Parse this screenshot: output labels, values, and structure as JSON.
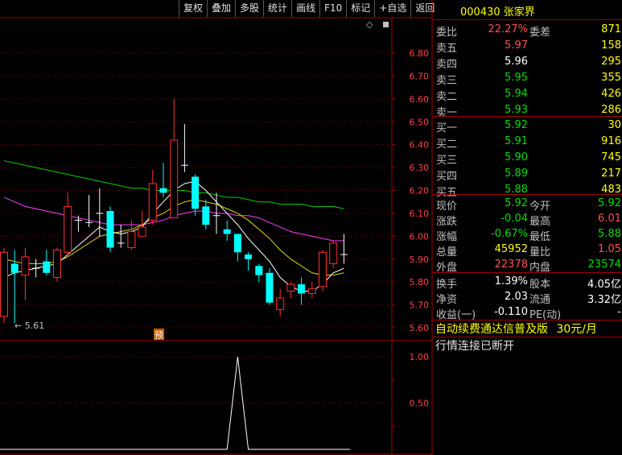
{
  "toolbar": [
    "复权",
    "叠加",
    "多股",
    "统计",
    "画线",
    "F10",
    "标记",
    "+自选",
    "返回"
  ],
  "stock": {
    "code": "000430",
    "name": "张家界"
  },
  "quote_rows": [
    {
      "l": "委比",
      "v": "22.27%",
      "vc": "red",
      "l2": "委差",
      "v2": "871",
      "v2c": "yellow"
    },
    {
      "l": "卖五",
      "v": "5.97",
      "vc": "red",
      "v2": "158",
      "v2c": "yellow"
    },
    {
      "l": "卖四",
      "v": "5.96",
      "vc": "white",
      "v2": "295",
      "v2c": "yellow"
    },
    {
      "l": "卖三",
      "v": "5.95",
      "vc": "green",
      "v2": "355",
      "v2c": "yellow"
    },
    {
      "l": "卖二",
      "v": "5.94",
      "vc": "green",
      "v2": "426",
      "v2c": "yellow"
    },
    {
      "l": "卖一",
      "v": "5.93",
      "vc": "green",
      "v2": "286",
      "v2c": "yellow"
    },
    {
      "l": "买一",
      "v": "5.92",
      "vc": "green",
      "v2": "30",
      "v2c": "yellow"
    },
    {
      "l": "买二",
      "v": "5.91",
      "vc": "green",
      "v2": "916",
      "v2c": "yellow"
    },
    {
      "l": "买三",
      "v": "5.90",
      "vc": "green",
      "v2": "745",
      "v2c": "yellow"
    },
    {
      "l": "买四",
      "v": "5.89",
      "vc": "green",
      "v2": "217",
      "v2c": "yellow"
    },
    {
      "l": "买五",
      "v": "5.88",
      "vc": "green",
      "v2": "483",
      "v2c": "yellow"
    },
    {
      "l": "现价",
      "v": "5.92",
      "vc": "green",
      "l2": "今开",
      "v2": "5.92",
      "v2c": "green"
    },
    {
      "l": "涨跌",
      "v": "-0.04",
      "vc": "green",
      "l2": "最高",
      "v2": "6.01",
      "v2c": "red"
    },
    {
      "l": "涨幅",
      "v": "-0.67%",
      "vc": "green",
      "l2": "最低",
      "v2": "5.88",
      "v2c": "green"
    },
    {
      "l": "总量",
      "v": "45952",
      "vc": "yellow",
      "l2": "量比",
      "v2": "1.05",
      "v2c": "red"
    },
    {
      "l": "外盘",
      "v": "22378",
      "vc": "red",
      "l2": "内盘",
      "v2": "23574",
      "v2c": "green"
    },
    {
      "l": "换手",
      "v": "1.39%",
      "vc": "white",
      "l2": "股本",
      "v2": "4.05亿",
      "v2c": "white"
    },
    {
      "l": "净资",
      "v": "2.03",
      "vc": "white",
      "l2": "流通",
      "v2": "3.32亿",
      "v2c": "white"
    },
    {
      "l": "收益(一)",
      "v": "-0.110",
      "vc": "white",
      "l2": "PE(动)",
      "v2": "-",
      "v2c": "white"
    }
  ],
  "ad_text": "自动续费通达信普及版",
  "ad_price": "30元/月",
  "status_text": "行情连接已断开",
  "low_marker": "← 5.61",
  "pre_marker": "预",
  "diamond": "◇",
  "chart_data": {
    "type": "candlestick",
    "y_ticks": [
      "6.80",
      "6.70",
      "6.60",
      "6.50",
      "6.40",
      "6.30",
      "6.20",
      "6.10",
      "6.00",
      "5.90",
      "5.80",
      "5.70",
      "5.60"
    ],
    "y_range": [
      5.58,
      6.86
    ],
    "low_label": 5.61,
    "candles": [
      {
        "o": 5.65,
        "c": 5.93,
        "h": 5.95,
        "l": 5.62
      },
      {
        "o": 5.88,
        "c": 5.84,
        "h": 5.94,
        "l": 5.62
      },
      {
        "o": 5.83,
        "c": 5.91,
        "h": 5.95,
        "l": 5.72
      },
      {
        "o": 5.86,
        "c": 5.86,
        "h": 5.9,
        "l": 5.82
      },
      {
        "o": 5.89,
        "c": 5.84,
        "h": 5.94,
        "l": 5.83
      },
      {
        "o": 5.82,
        "c": 5.94,
        "h": 5.95,
        "l": 5.8
      },
      {
        "o": 5.93,
        "c": 6.13,
        "h": 6.19,
        "l": 5.91
      },
      {
        "o": 6.07,
        "c": 6.07,
        "h": 6.09,
        "l": 6.02
      },
      {
        "o": 6.06,
        "c": 6.06,
        "h": 6.18,
        "l": 6.04
      },
      {
        "o": 6.1,
        "c": 6.1,
        "h": 6.21,
        "l": 6.0
      },
      {
        "o": 6.11,
        "c": 5.95,
        "h": 6.13,
        "l": 5.93
      },
      {
        "o": 5.97,
        "c": 5.97,
        "h": 6.05,
        "l": 5.95
      },
      {
        "o": 5.95,
        "c": 6.02,
        "h": 6.07,
        "l": 5.94
      },
      {
        "o": 6.0,
        "c": 6.04,
        "h": 6.11,
        "l": 6.0
      },
      {
        "o": 6.07,
        "c": 6.23,
        "h": 6.29,
        "l": 6.05
      },
      {
        "o": 6.21,
        "c": 6.19,
        "h": 6.32,
        "l": 6.17
      },
      {
        "o": 6.08,
        "c": 6.42,
        "h": 6.6,
        "l": 6.08
      },
      {
        "o": 6.31,
        "c": 6.31,
        "h": 6.49,
        "l": 6.28
      },
      {
        "o": 6.26,
        "c": 6.12,
        "h": 6.27,
        "l": 6.09
      },
      {
        "o": 6.13,
        "c": 6.05,
        "h": 6.16,
        "l": 6.03
      },
      {
        "o": 6.09,
        "c": 6.09,
        "h": 6.19,
        "l": 6.01
      },
      {
        "o": 6.03,
        "c": 6.01,
        "h": 6.07,
        "l": 5.98
      },
      {
        "o": 6.01,
        "c": 5.93,
        "h": 6.01,
        "l": 5.89
      },
      {
        "o": 5.92,
        "c": 5.9,
        "h": 5.93,
        "l": 5.85
      },
      {
        "o": 5.87,
        "c": 5.83,
        "h": 5.88,
        "l": 5.8
      },
      {
        "o": 5.84,
        "c": 5.71,
        "h": 5.86,
        "l": 5.7
      },
      {
        "o": 5.68,
        "c": 5.73,
        "h": 5.77,
        "l": 5.65
      },
      {
        "o": 5.76,
        "c": 5.79,
        "h": 5.8,
        "l": 5.73
      },
      {
        "o": 5.79,
        "c": 5.75,
        "h": 5.82,
        "l": 5.7
      },
      {
        "o": 5.75,
        "c": 5.77,
        "h": 5.8,
        "l": 5.73
      },
      {
        "o": 5.78,
        "c": 5.93,
        "h": 5.94,
        "l": 5.76
      },
      {
        "o": 5.88,
        "c": 5.97,
        "h": 5.98,
        "l": 5.86
      },
      {
        "o": 5.92,
        "c": 5.92,
        "h": 6.01,
        "l": 5.88
      }
    ],
    "ma_white": [
      5.82,
      5.84,
      5.85,
      5.86,
      5.87,
      5.88,
      5.92,
      5.96,
      6.0,
      6.04,
      6.02,
      6.01,
      6.02,
      6.04,
      6.1,
      6.15,
      6.2,
      6.23,
      6.24,
      6.2,
      6.15,
      6.1,
      6.05,
      5.99,
      5.94,
      5.89,
      5.82,
      5.78,
      5.76,
      5.76,
      5.79,
      5.84,
      5.86
    ],
    "ma_yellow": [
      5.9,
      5.89,
      5.88,
      5.88,
      5.88,
      5.89,
      5.91,
      5.94,
      5.97,
      6.0,
      6.01,
      6.02,
      6.03,
      6.05,
      6.08,
      6.1,
      6.13,
      6.15,
      6.16,
      6.15,
      6.14,
      6.12,
      6.1,
      6.07,
      6.03,
      5.99,
      5.94,
      5.9,
      5.87,
      5.84,
      5.83,
      5.83,
      5.84
    ],
    "ma_magenta": [
      6.17,
      6.15,
      6.13,
      6.12,
      6.11,
      6.1,
      6.09,
      6.08,
      6.07,
      6.06,
      6.05,
      6.05,
      6.05,
      6.05,
      6.06,
      6.07,
      6.09,
      6.1,
      6.11,
      6.11,
      6.1,
      6.1,
      6.09,
      6.09,
      6.08,
      6.06,
      6.04,
      6.02,
      6.01,
      6.0,
      5.99,
      5.98,
      5.98
    ],
    "ma_green": [
      6.33,
      6.32,
      6.31,
      6.3,
      6.29,
      6.28,
      6.27,
      6.26,
      6.25,
      6.24,
      6.23,
      6.22,
      6.21,
      6.21,
      6.2,
      6.2,
      6.2,
      6.2,
      6.19,
      6.19,
      6.18,
      6.17,
      6.17,
      6.16,
      6.15,
      6.15,
      6.14,
      6.14,
      6.14,
      6.13,
      6.13,
      6.13,
      6.12
    ],
    "sub_ticks": [
      "1.00",
      "0.50"
    ],
    "sub_range": [
      0,
      1.1
    ],
    "sub_values": [
      0,
      0,
      0,
      0,
      0,
      0,
      0,
      0,
      0,
      0,
      0,
      0,
      0,
      0,
      0,
      0,
      0,
      0,
      0,
      0,
      0,
      0,
      0,
      0,
      0,
      0,
      0,
      0,
      0,
      0,
      0,
      0,
      0
    ],
    "sub_spike": {
      "index": 22,
      "value": 1.0
    }
  },
  "colors": {
    "up": "#ff3030",
    "down": "#00ffff",
    "ma_white": "#ffffff",
    "ma_yellow": "#e0e000",
    "ma_magenta": "#ff40ff",
    "ma_green": "#00d000",
    "frame": "#a00000",
    "grid": "#800000"
  }
}
